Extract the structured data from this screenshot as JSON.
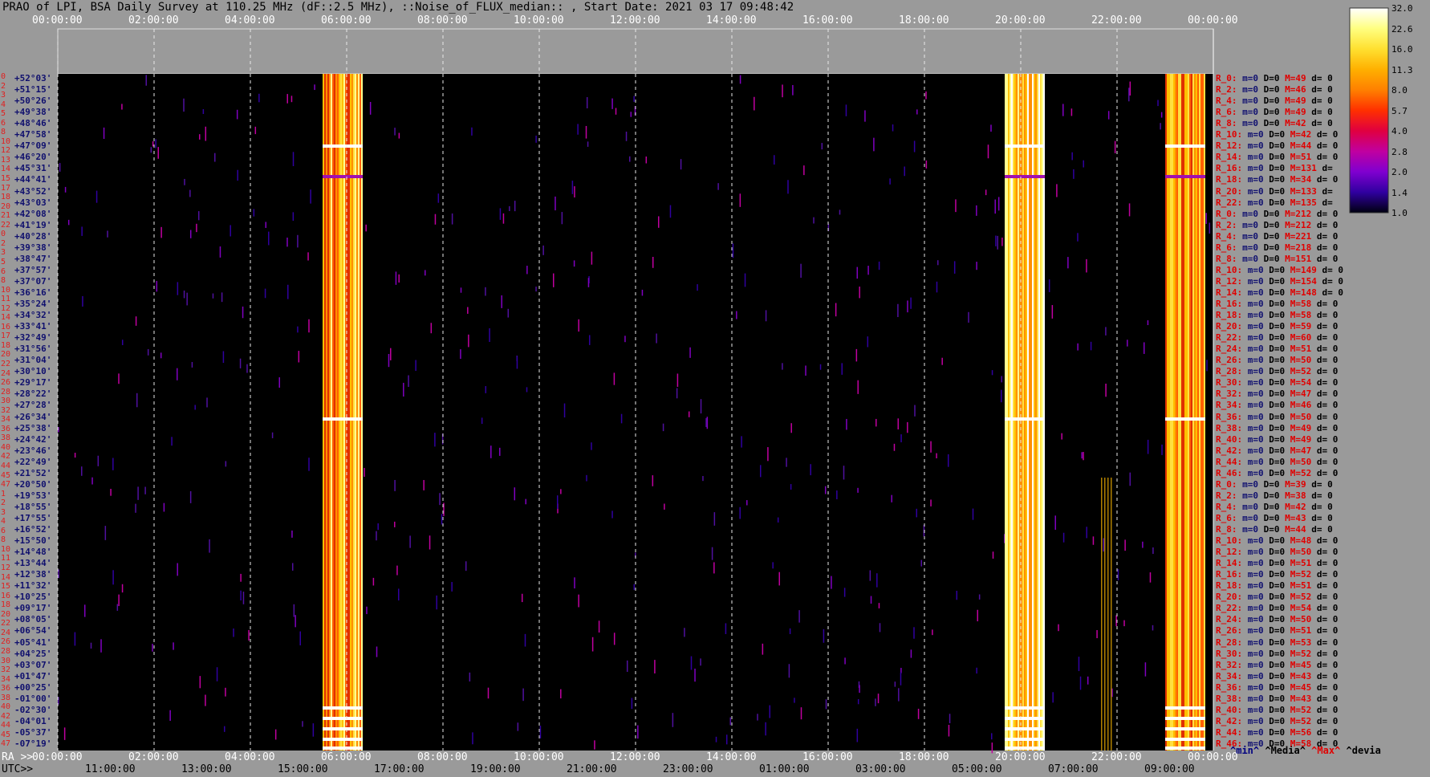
{
  "title": "PRAO of LPI, BSA Daily Survey at 110.25 MHz (dF::2.5 MHz), ::Noise_of_FLUX_median:: , Start Date: 2021 03 17 09:48:42",
  "chart_data": {
    "type": "heatmap",
    "title": "PRAO of LPI, BSA Daily Survey at 110.25 MHz (dF::2.5 MHz), ::Noise_of_FLUX_median:: , Start Date: 2021 03 17 09:48:42",
    "x_top_ticks": [
      "00:00:00",
      "02:00:00",
      "04:00:00",
      "06:00:00",
      "08:00:00",
      "10:00:00",
      "12:00:00",
      "14:00:00",
      "16:00:00",
      "18:00:00",
      "20:00:00",
      "22:00:00",
      "00:00:00"
    ],
    "x_ra_label": "RA >>",
    "x_ra_ticks": [
      "00:00:00",
      "02:00:00",
      "04:00:00",
      "06:00:00",
      "08:00:00",
      "10:00:00",
      "12:00:00",
      "14:00:00",
      "16:00:00",
      "18:00:00",
      "20:00:00",
      "22:00:00",
      "00:00:00"
    ],
    "x_utc_label": "UTC>>",
    "x_utc_ticks": [
      "11:00:00",
      "13:00:00",
      "15:00:00",
      "17:00:00",
      "19:00:00",
      "21:00:00",
      "23:00:00",
      "01:00:00",
      "03:00:00",
      "05:00:00",
      "07:00:00",
      "09:00:00"
    ],
    "row_numbers": [
      "0",
      "2",
      "3",
      "4",
      "5",
      "6",
      "8",
      "10",
      "12",
      "13",
      "14",
      "15",
      "17",
      "18",
      "20",
      "21",
      "22",
      "0",
      "2",
      "3",
      "5",
      "6",
      "8",
      "10",
      "11",
      "12",
      "14",
      "16",
      "17",
      "18",
      "20",
      "22",
      "24",
      "26",
      "28",
      "30",
      "32",
      "34",
      "36",
      "38",
      "40",
      "42",
      "44",
      "45",
      "47",
      "1",
      "2",
      "3",
      "4",
      "6",
      "8",
      "10",
      "11",
      "12",
      "14",
      "15",
      "16",
      "18",
      "20",
      "22",
      "24",
      "26",
      "28",
      "30",
      "32",
      "34",
      "36",
      "38",
      "40",
      "42",
      "44",
      "45",
      "47"
    ],
    "declinations": [
      "+52°03'",
      "+51°15'",
      "+50°26'",
      "+49°38'",
      "+48°46'",
      "+47°58'",
      "+47°09'",
      "+46°20'",
      "+45°31'",
      "+44°41'",
      "+43°52'",
      "+43°03'",
      "+42°08'",
      "+41°19'",
      "+40°28'",
      "+39°38'",
      "+38°47'",
      "+37°57'",
      "+37°07'",
      "+36°16'",
      "+35°24'",
      "+34°32'",
      "+33°41'",
      "+32°49'",
      "+31°56'",
      "+31°04'",
      "+30°10'",
      "+29°17'",
      "+28°22'",
      "+27°28'",
      "+26°34'",
      "+25°38'",
      "+24°42'",
      "+23°46'",
      "+22°49'",
      "+21°52'",
      "+20°50'",
      "+19°53'",
      "+18°55'",
      "+17°55'",
      "+16°52'",
      "+15°50'",
      "+14°48'",
      "+13°44'",
      "+12°38'",
      "+11°32'",
      "+10°25'",
      "+09°17'",
      "+08°05'",
      "+06°54'",
      "+05°41'",
      "+04°25'",
      "+03°07'",
      "+01°47'",
      "+00°25'",
      "-01°00'",
      "-02°30'",
      "-04°01'",
      "-05°37'",
      "-07°19'"
    ],
    "bright_bands": [
      {
        "x_start": "05:30:00",
        "x_end": "06:20:00"
      },
      {
        "x_start": "19:40:00",
        "x_end": "20:30:00"
      },
      {
        "x_start": "23:00:00",
        "x_end": "23:50:00"
      }
    ],
    "colorbar": {
      "ticks": [
        "32.0",
        "22.6",
        "16.0",
        "11.3",
        "8.0",
        "5.7",
        "4.0",
        "2.8",
        "2.0",
        "1.4",
        "1.0"
      ],
      "colors": [
        "#ffffff",
        "#ffff80",
        "#ffe030",
        "#ffb000",
        "#ff8000",
        "#ff3000",
        "#e00040",
        "#c000a0",
        "#8000d0",
        "#3000a0",
        "#000010"
      ]
    },
    "stats": [
      {
        "r": "R_0:",
        "m": "m=0",
        "D": "D=0",
        "M": "M=49",
        "d": "d= 0"
      },
      {
        "r": "R_2:",
        "m": "m=0",
        "D": "D=0",
        "M": "M=46",
        "d": "d= 0"
      },
      {
        "r": "R_4:",
        "m": "m=0",
        "D": "D=0",
        "M": "M=49",
        "d": "d= 0"
      },
      {
        "r": "R_6:",
        "m": "m=0",
        "D": "D=0",
        "M": "M=49",
        "d": "d= 0"
      },
      {
        "r": "R_8:",
        "m": "m=0",
        "D": "D=0",
        "M": "M=42",
        "d": "d= 0"
      },
      {
        "r": "R_10:",
        "m": "m=0",
        "D": "D=0",
        "M": "M=42",
        "d": "d= 0"
      },
      {
        "r": "R_12:",
        "m": "m=0",
        "D": "D=0",
        "M": "M=44",
        "d": "d= 0"
      },
      {
        "r": "R_14:",
        "m": "m=0",
        "D": "D=0",
        "M": "M=51",
        "d": "d= 0"
      },
      {
        "r": "R_16:",
        "m": "m=0",
        "D": "D=0",
        "M": "M=131",
        "d": "d="
      },
      {
        "r": "R_18:",
        "m": "m=0",
        "D": "D=0",
        "M": "M=34",
        "d": "d= 0"
      },
      {
        "r": "R_20:",
        "m": "m=0",
        "D": "D=0",
        "M": "M=133",
        "d": "d="
      },
      {
        "r": "R_22:",
        "m": "m=0",
        "D": "D=0",
        "M": "M=135",
        "d": "d="
      },
      {
        "r": "R_0:",
        "m": "m=0",
        "D": "D=0",
        "M": "M=212",
        "d": "d= 0"
      },
      {
        "r": "R_2:",
        "m": "m=0",
        "D": "D=0",
        "M": "M=212",
        "d": "d= 0"
      },
      {
        "r": "R_4:",
        "m": "m=0",
        "D": "D=0",
        "M": "M=221",
        "d": "d= 0"
      },
      {
        "r": "R_6:",
        "m": "m=0",
        "D": "D=0",
        "M": "M=218",
        "d": "d= 0"
      },
      {
        "r": "R_8:",
        "m": "m=0",
        "D": "D=0",
        "M": "M=151",
        "d": "d= 0"
      },
      {
        "r": "R_10:",
        "m": "m=0",
        "D": "D=0",
        "M": "M=149",
        "d": "d= 0"
      },
      {
        "r": "R_12:",
        "m": "m=0",
        "D": "D=0",
        "M": "M=154",
        "d": "d= 0"
      },
      {
        "r": "R_14:",
        "m": "m=0",
        "D": "D=0",
        "M": "M=148",
        "d": "d= 0"
      },
      {
        "r": "R_16:",
        "m": "m=0",
        "D": "D=0",
        "M": "M=58",
        "d": "d= 0"
      },
      {
        "r": "R_18:",
        "m": "m=0",
        "D": "D=0",
        "M": "M=58",
        "d": "d= 0"
      },
      {
        "r": "R_20:",
        "m": "m=0",
        "D": "D=0",
        "M": "M=59",
        "d": "d= 0"
      },
      {
        "r": "R_22:",
        "m": "m=0",
        "D": "D=0",
        "M": "M=60",
        "d": "d= 0"
      },
      {
        "r": "R_24:",
        "m": "m=0",
        "D": "D=0",
        "M": "M=51",
        "d": "d= 0"
      },
      {
        "r": "R_26:",
        "m": "m=0",
        "D": "D=0",
        "M": "M=50",
        "d": "d= 0"
      },
      {
        "r": "R_28:",
        "m": "m=0",
        "D": "D=0",
        "M": "M=52",
        "d": "d= 0"
      },
      {
        "r": "R_30:",
        "m": "m=0",
        "D": "D=0",
        "M": "M=54",
        "d": "d= 0"
      },
      {
        "r": "R_32:",
        "m": "m=0",
        "D": "D=0",
        "M": "M=47",
        "d": "d= 0"
      },
      {
        "r": "R_34:",
        "m": "m=0",
        "D": "D=0",
        "M": "M=46",
        "d": "d= 0"
      },
      {
        "r": "R_36:",
        "m": "m=0",
        "D": "D=0",
        "M": "M=50",
        "d": "d= 0"
      },
      {
        "r": "R_38:",
        "m": "m=0",
        "D": "D=0",
        "M": "M=49",
        "d": "d= 0"
      },
      {
        "r": "R_40:",
        "m": "m=0",
        "D": "D=0",
        "M": "M=49",
        "d": "d= 0"
      },
      {
        "r": "R_42:",
        "m": "m=0",
        "D": "D=0",
        "M": "M=47",
        "d": "d= 0"
      },
      {
        "r": "R_44:",
        "m": "m=0",
        "D": "D=0",
        "M": "M=50",
        "d": "d= 0"
      },
      {
        "r": "R_46:",
        "m": "m=0",
        "D": "D=0",
        "M": "M=52",
        "d": "d= 0"
      },
      {
        "r": "R_0:",
        "m": "m=0",
        "D": "D=0",
        "M": "M=39",
        "d": "d= 0"
      },
      {
        "r": "R_2:",
        "m": "m=0",
        "D": "D=0",
        "M": "M=38",
        "d": "d= 0"
      },
      {
        "r": "R_4:",
        "m": "m=0",
        "D": "D=0",
        "M": "M=42",
        "d": "d= 0"
      },
      {
        "r": "R_6:",
        "m": "m=0",
        "D": "D=0",
        "M": "M=43",
        "d": "d= 0"
      },
      {
        "r": "R_8:",
        "m": "m=0",
        "D": "D=0",
        "M": "M=44",
        "d": "d= 0"
      },
      {
        "r": "R_10:",
        "m": "m=0",
        "D": "D=0",
        "M": "M=48",
        "d": "d= 0"
      },
      {
        "r": "R_12:",
        "m": "m=0",
        "D": "D=0",
        "M": "M=50",
        "d": "d= 0"
      },
      {
        "r": "R_14:",
        "m": "m=0",
        "D": "D=0",
        "M": "M=51",
        "d": "d= 0"
      },
      {
        "r": "R_16:",
        "m": "m=0",
        "D": "D=0",
        "M": "M=52",
        "d": "d= 0"
      },
      {
        "r": "R_18:",
        "m": "m=0",
        "D": "D=0",
        "M": "M=51",
        "d": "d= 0"
      },
      {
        "r": "R_20:",
        "m": "m=0",
        "D": "D=0",
        "M": "M=52",
        "d": "d= 0"
      },
      {
        "r": "R_22:",
        "m": "m=0",
        "D": "D=0",
        "M": "M=54",
        "d": "d= 0"
      },
      {
        "r": "R_24:",
        "m": "m=0",
        "D": "D=0",
        "M": "M=50",
        "d": "d= 0"
      },
      {
        "r": "R_26:",
        "m": "m=0",
        "D": "D=0",
        "M": "M=51",
        "d": "d= 0"
      },
      {
        "r": "R_28:",
        "m": "m=0",
        "D": "D=0",
        "M": "M=53",
        "d": "d= 0"
      },
      {
        "r": "R_30:",
        "m": "m=0",
        "D": "D=0",
        "M": "M=52",
        "d": "d= 0"
      },
      {
        "r": "R_32:",
        "m": "m=0",
        "D": "D=0",
        "M": "M=45",
        "d": "d= 0"
      },
      {
        "r": "R_34:",
        "m": "m=0",
        "D": "D=0",
        "M": "M=43",
        "d": "d= 0"
      },
      {
        "r": "R_36:",
        "m": "m=0",
        "D": "D=0",
        "M": "M=45",
        "d": "d= 0"
      },
      {
        "r": "R_38:",
        "m": "m=0",
        "D": "D=0",
        "M": "M=43",
        "d": "d= 0"
      },
      {
        "r": "R_40:",
        "m": "m=0",
        "D": "D=0",
        "M": "M=52",
        "d": "d= 0"
      },
      {
        "r": "R_42:",
        "m": "m=0",
        "D": "D=0",
        "M": "M=52",
        "d": "d= 0"
      },
      {
        "r": "R_44:",
        "m": "m=0",
        "D": "D=0",
        "M": "M=56",
        "d": "d= 0"
      },
      {
        "r": "R_46:",
        "m": "m=0",
        "D": "D=0",
        "M": "M=58",
        "d": "d= 0"
      }
    ]
  },
  "legend": {
    "min": "^min^",
    "media": "^Media^",
    "max": "^Max^",
    "devia": "^devia"
  }
}
